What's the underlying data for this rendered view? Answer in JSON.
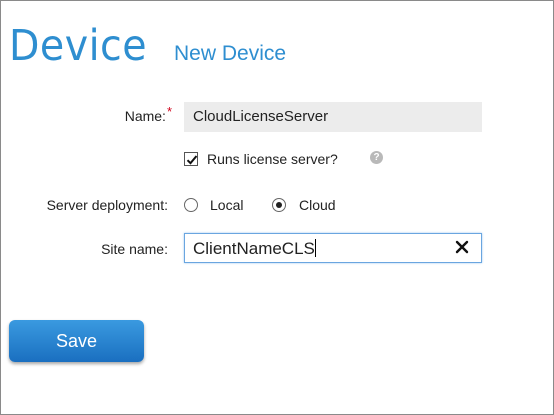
{
  "header": {
    "title": "Device",
    "subtitle": "New Device"
  },
  "form": {
    "name": {
      "label": "Name:",
      "required_mark": "*",
      "value": "CloudLicenseServer"
    },
    "runs_license_server": {
      "label": "Runs license server?",
      "checked": true,
      "help_icon": "question-icon"
    },
    "server_deployment": {
      "label": "Server deployment:",
      "options": [
        "Local",
        "Cloud"
      ],
      "selected": "Cloud"
    },
    "site_name": {
      "label": "Site name:",
      "value": "ClientNameCLS",
      "clear_icon": "close-icon"
    }
  },
  "actions": {
    "save_label": "Save"
  },
  "colors": {
    "accent": "#2e8ed0",
    "button": "#1f7ac8",
    "required": "#d0021b"
  }
}
